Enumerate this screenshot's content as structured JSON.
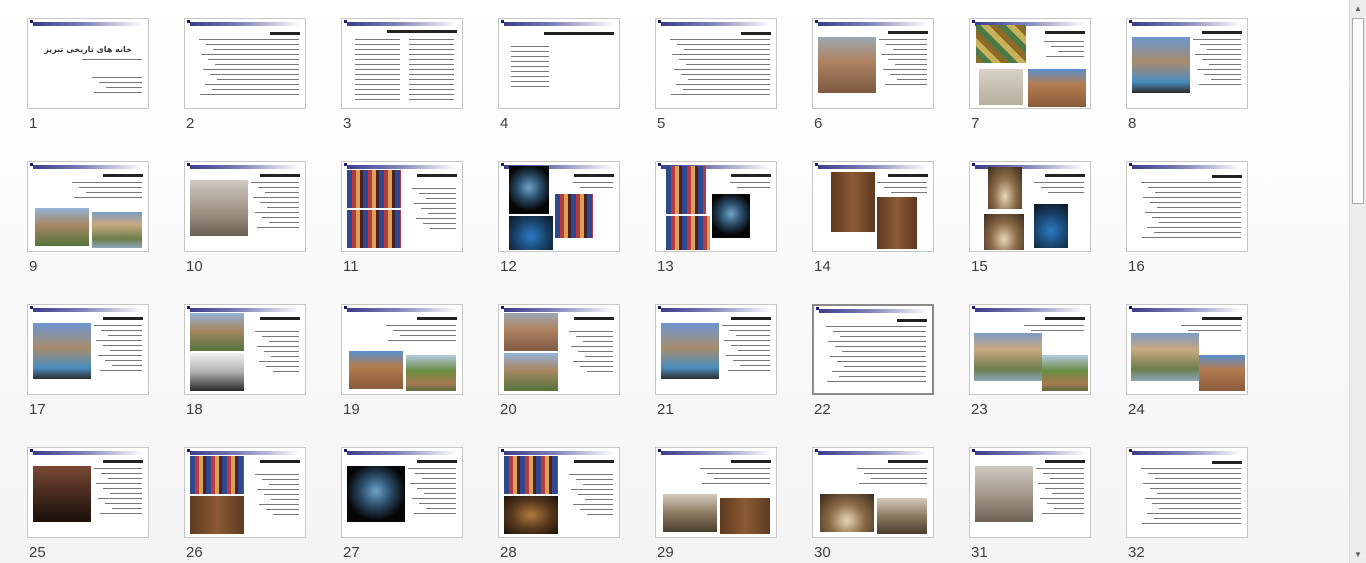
{
  "slides": [
    {
      "number": "1",
      "title": "خانه های تاریخی تبریز",
      "variant": "cover"
    },
    {
      "number": "2",
      "variant": "text"
    },
    {
      "number": "3",
      "variant": "twocol"
    },
    {
      "number": "4",
      "variant": "list"
    },
    {
      "number": "5",
      "variant": "text"
    },
    {
      "number": "6",
      "variant": "imgL",
      "imgs": [
        "p-brick"
      ]
    },
    {
      "number": "7",
      "variant": "three",
      "imgs": [
        "p-mosaic",
        "p-stone",
        "p-facade"
      ]
    },
    {
      "number": "8",
      "variant": "imgL",
      "imgs": [
        "p-pool"
      ]
    },
    {
      "number": "9",
      "variant": "twoBottom",
      "imgs": [
        "p-garden",
        "p-court"
      ]
    },
    {
      "number": "10",
      "variant": "imgL",
      "imgs": [
        "p-pale"
      ]
    },
    {
      "number": "11",
      "variant": "twoLeft",
      "imgs": [
        "p-glass",
        "p-glass"
      ]
    },
    {
      "number": "12",
      "variant": "windows",
      "imgs": [
        "p-dark",
        "p-glass",
        "p-blue"
      ]
    },
    {
      "number": "13",
      "variant": "windows",
      "imgs": [
        "p-glass",
        "p-dark",
        "p-glass"
      ]
    },
    {
      "number": "14",
      "variant": "doors",
      "imgs": [
        "p-wood",
        "p-wood"
      ]
    },
    {
      "number": "15",
      "variant": "arches",
      "imgs": [
        "p-arch",
        "p-arch",
        "p-blue"
      ]
    },
    {
      "number": "16",
      "variant": "text"
    },
    {
      "number": "17",
      "variant": "imgL",
      "imgs": [
        "p-pool"
      ]
    },
    {
      "number": "18",
      "variant": "twoLeft",
      "imgs": [
        "p-garden",
        "p-hall"
      ]
    },
    {
      "number": "19",
      "variant": "twoBottom",
      "imgs": [
        "p-facade",
        "p-tree"
      ]
    },
    {
      "number": "20",
      "variant": "twoLeft",
      "imgs": [
        "p-brick",
        "p-garden"
      ]
    },
    {
      "number": "21",
      "variant": "imgL",
      "imgs": [
        "p-pool"
      ]
    },
    {
      "number": "22",
      "variant": "text",
      "selected": true
    },
    {
      "number": "23",
      "variant": "twoStagger",
      "imgs": [
        "p-court",
        "p-tree"
      ]
    },
    {
      "number": "24",
      "variant": "twoStagger",
      "imgs": [
        "p-court",
        "p-facade"
      ]
    },
    {
      "number": "25",
      "variant": "imgL",
      "imgs": [
        "p-door"
      ]
    },
    {
      "number": "26",
      "variant": "twoLeft",
      "imgs": [
        "p-glass",
        "p-wood"
      ]
    },
    {
      "number": "27",
      "variant": "imgL",
      "imgs": [
        "p-dark"
      ]
    },
    {
      "number": "28",
      "variant": "twoLeft",
      "imgs": [
        "p-glass",
        "p-statue"
      ]
    },
    {
      "number": "29",
      "variant": "twoBottom",
      "imgs": [
        "p-gallery",
        "p-wood"
      ]
    },
    {
      "number": "30",
      "variant": "twoBottom",
      "imgs": [
        "p-arch",
        "p-gallery"
      ]
    },
    {
      "number": "31",
      "variant": "imgL",
      "imgs": [
        "p-pale"
      ]
    },
    {
      "number": "32",
      "variant": "text"
    }
  ],
  "scrollbar": {
    "up_icon": "▲",
    "down_icon": "▼"
  }
}
